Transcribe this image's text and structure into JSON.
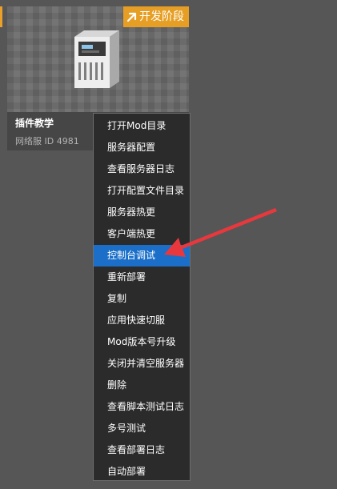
{
  "card": {
    "badge_label": "开发阶段",
    "title": "插件教学",
    "subtitle": "网络服 ID 4981"
  },
  "context_menu": {
    "active_index": 6,
    "items": [
      {
        "label": "打开Mod目录"
      },
      {
        "label": "服务器配置"
      },
      {
        "label": "查看服务器日志"
      },
      {
        "label": "打开配置文件目录"
      },
      {
        "label": "服务器热更"
      },
      {
        "label": "客户端热更"
      },
      {
        "label": "控制台调试"
      },
      {
        "label": "重新部署"
      },
      {
        "label": "复制"
      },
      {
        "label": "应用快速切服"
      },
      {
        "label": "Mod版本号升级"
      },
      {
        "label": "关闭并清空服务器"
      },
      {
        "label": "删除"
      },
      {
        "label": "查看脚本测试日志"
      },
      {
        "label": "多号测试"
      },
      {
        "label": "查看部署日志"
      },
      {
        "label": "自动部署"
      }
    ]
  },
  "colors": {
    "background": "#565656",
    "badge": "#e69f24",
    "menu_highlight": "#1b6fc8",
    "annotation_arrow": "#e8383d"
  },
  "icons": {
    "badge_icon": "arrow-up-right-icon",
    "card_image": "server-icon"
  }
}
